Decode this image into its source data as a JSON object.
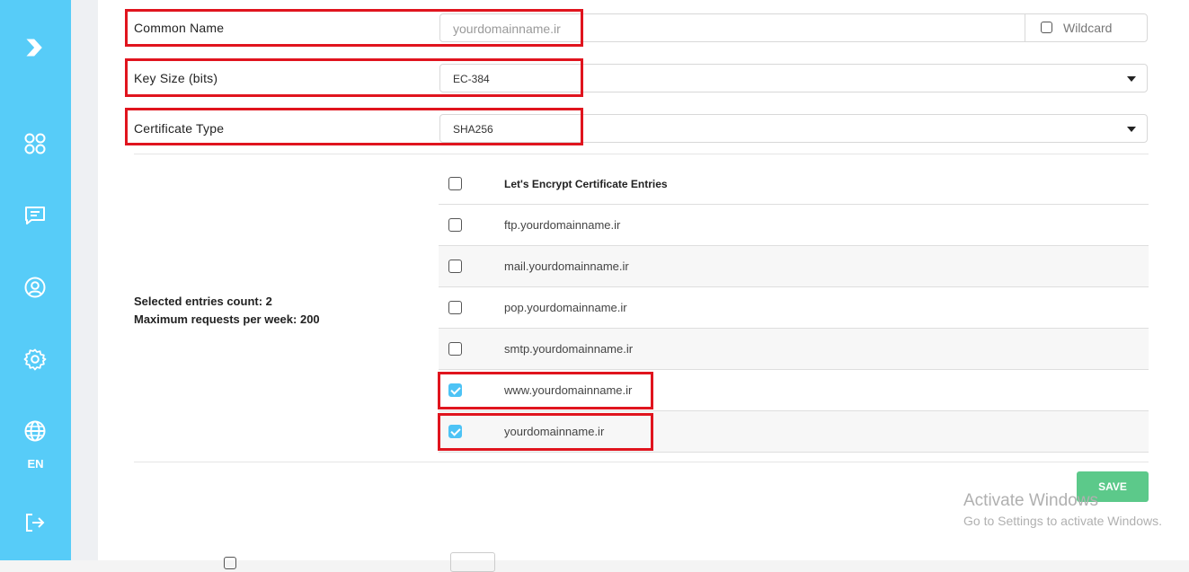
{
  "sidebar": {
    "icons": [
      "arrow-logo-icon",
      "apps-icon",
      "chat-icon",
      "user-icon",
      "settings-icon",
      "globe-icon",
      "logout-icon"
    ],
    "language": "EN"
  },
  "form": {
    "common_name": {
      "label": "Common Name",
      "placeholder": "yourdomainname.ir",
      "wildcard_label": "Wildcard"
    },
    "key_size": {
      "label": "Key Size (bits)",
      "value": "EC-384"
    },
    "certificate_type": {
      "label": "Certificate Type",
      "value": "SHA256"
    }
  },
  "summary": {
    "selected": "Selected entries count: 2",
    "max_requests": "Maximum requests per week: 200"
  },
  "entries": {
    "header": "Let's Encrypt Certificate Entries",
    "items": [
      {
        "label": "ftp.yourdomainname.ir",
        "checked": false
      },
      {
        "label": "mail.yourdomainname.ir",
        "checked": false
      },
      {
        "label": "pop.yourdomainname.ir",
        "checked": false
      },
      {
        "label": "smtp.yourdomainname.ir",
        "checked": false
      },
      {
        "label": "www.yourdomainname.ir",
        "checked": true
      },
      {
        "label": "yourdomainname.ir",
        "checked": true
      }
    ]
  },
  "save_label": "SAVE",
  "watermark": {
    "line1": "Activate Windows",
    "line2": "Go to Settings to activate Windows."
  },
  "colors": {
    "sidebar": "#57ccf8",
    "highlight": "#e0141e",
    "save": "#5cc98a",
    "checkbox_on": "#4dc3f5"
  }
}
